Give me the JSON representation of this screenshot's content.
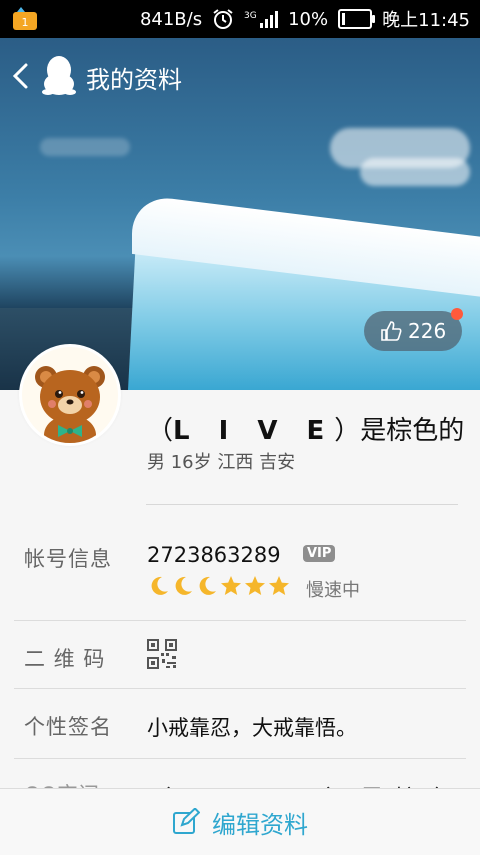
{
  "status": {
    "speed": "841B/s",
    "signal_text": "3G",
    "battery": "10%",
    "time": "晚上11:45"
  },
  "nav": {
    "title": "我的资料"
  },
  "likes": {
    "count": "226"
  },
  "profile": {
    "name_prefix": "（",
    "name_live": "L I V E",
    "name_suffix": "）是棕色的",
    "meta": "男 16岁 江西 吉安"
  },
  "rows": {
    "account": {
      "label": "帐号信息",
      "number": "2723863289",
      "vip": "VIP",
      "speed": "慢速中",
      "levels": [
        "moon-icon",
        "moon-icon",
        "moon-icon",
        "star-icon",
        "star-icon",
        "star-icon"
      ]
    },
    "qr": {
      "label": "二 维 码"
    },
    "signature": {
      "label": "个性签名",
      "value": "小戒靠忍，大戒靠悟。"
    },
    "space": {
      "label": "QQ空间",
      "value": "（L I V E）是棕色的"
    }
  },
  "footer": {
    "edit_label": "编辑资料"
  },
  "colors": {
    "accent": "#2fa7cf",
    "badge": "#ff5a3c"
  }
}
